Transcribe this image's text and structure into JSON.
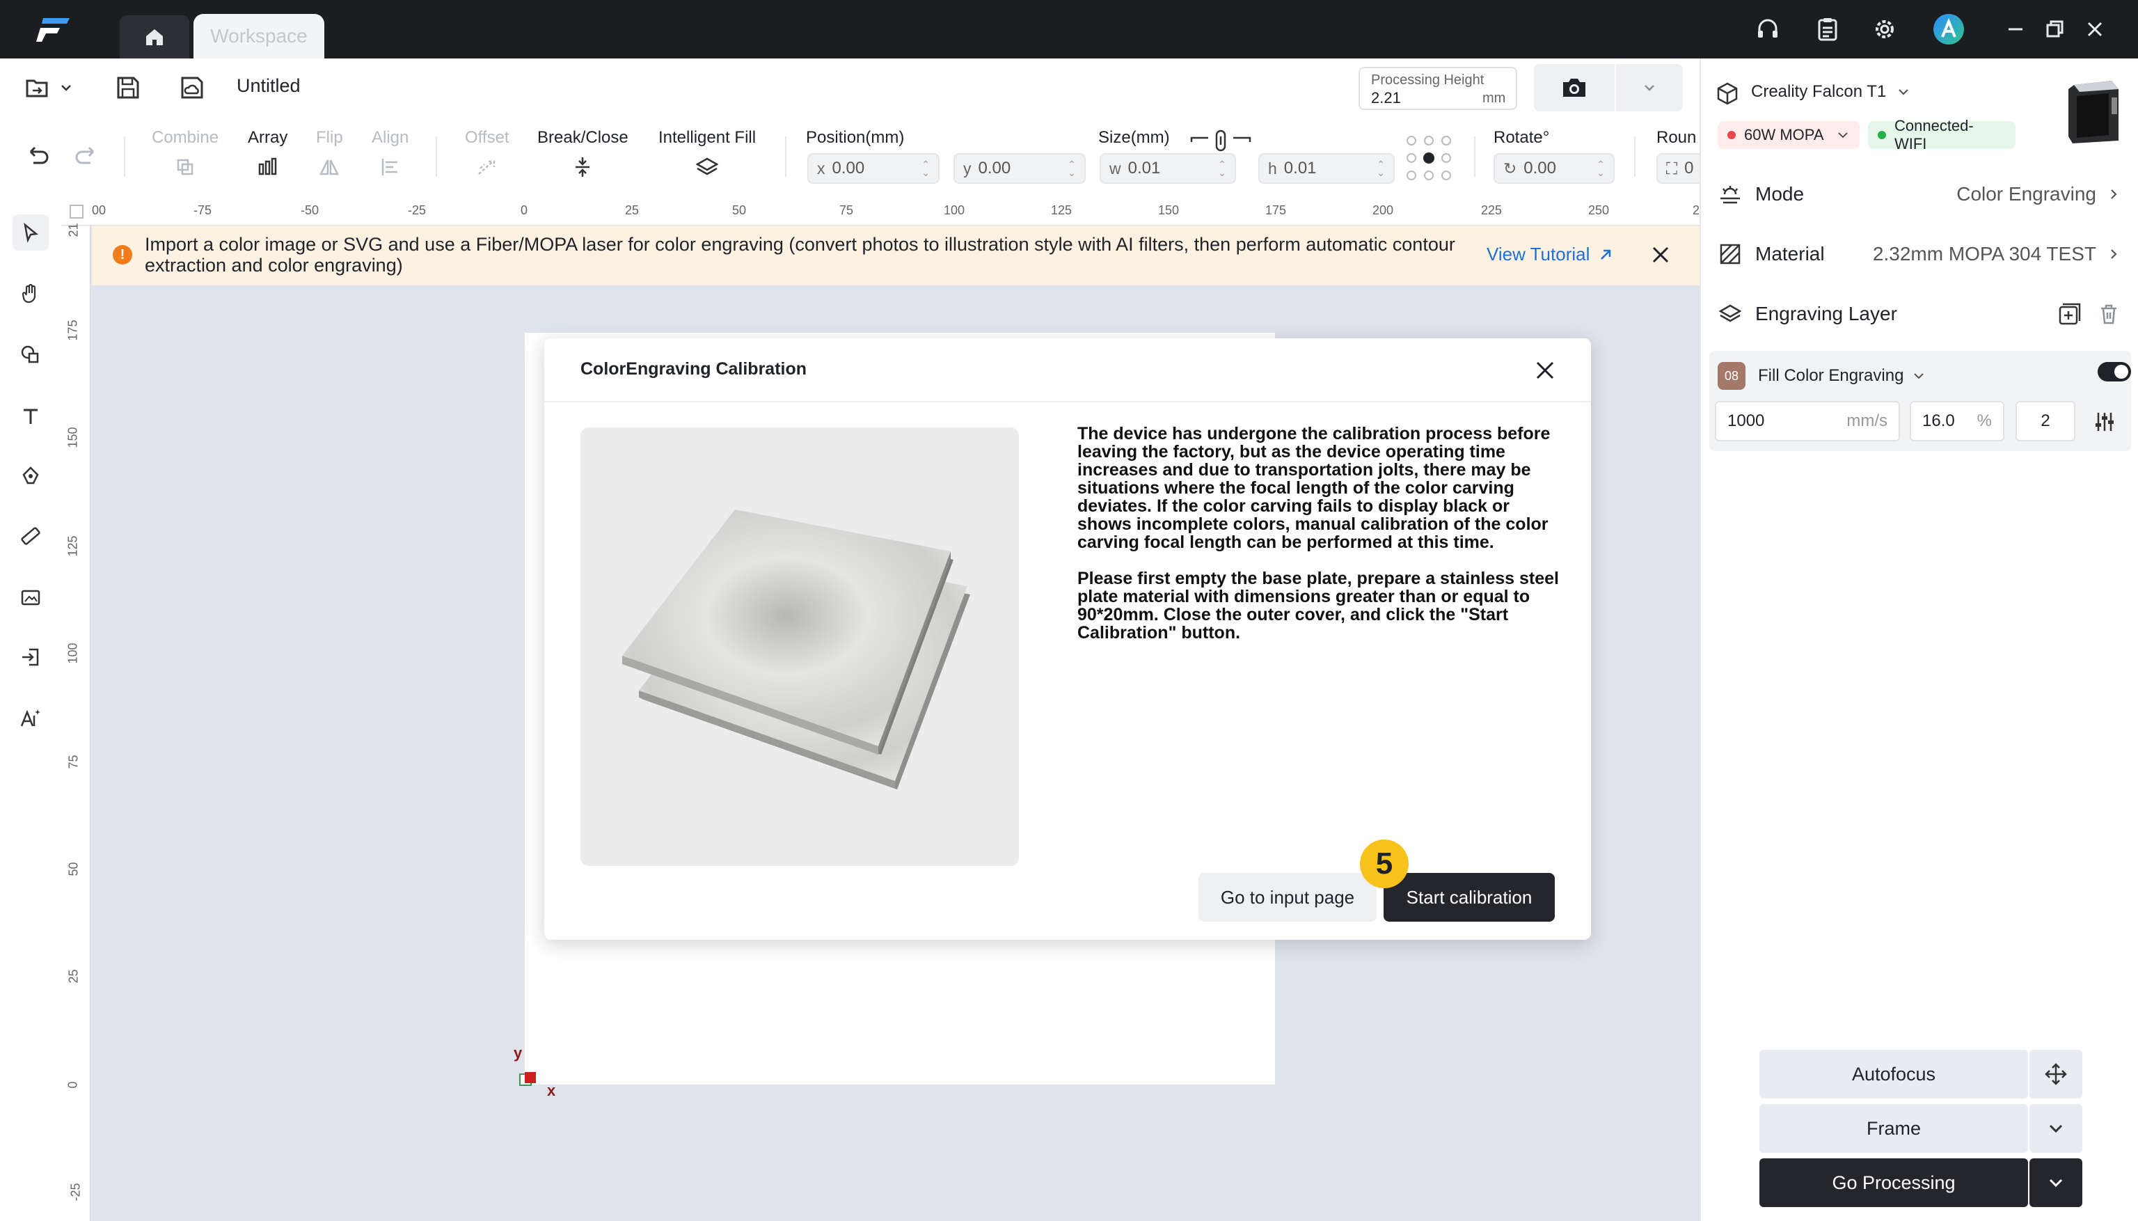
{
  "titlebar": {
    "workspace_tab": "Workspace",
    "icons": [
      "app-logo",
      "home-icon",
      "headset-icon",
      "clipboard-icon",
      "gear-icon",
      "avatar",
      "minimize-icon",
      "restore-icon",
      "close-icon"
    ]
  },
  "toolbar": {
    "document_title": "Untitled",
    "processing_height_label": "Processing Height",
    "processing_height_value": "2.21",
    "processing_height_unit": "mm"
  },
  "tools": {
    "combine": "Combine",
    "array": "Array",
    "flip": "Flip",
    "align": "Align",
    "offset": "Offset",
    "break_close": "Break/Close",
    "intelligent_fill": "Intelligent Fill",
    "position_label": "Position(mm)",
    "x_prefix": "x",
    "x_value": "0.00",
    "y_prefix": "y",
    "y_value": "0.00",
    "size_label": "Size(mm)",
    "w_prefix": "w",
    "w_value": "0.01",
    "h_prefix": "h",
    "h_value": "0.01",
    "rotate_label": "Rotate°",
    "rotate_value": "0.00",
    "round_label": "Roun",
    "round_value": "0"
  },
  "ruler": {
    "h_ticks": [
      "00",
      "-75",
      "-50",
      "-25",
      "0",
      "25",
      "50",
      "75",
      "100",
      "125",
      "150",
      "175",
      "200",
      "225",
      "250",
      "2"
    ],
    "v_ticks": [
      "21",
      "175",
      "150",
      "125",
      "100",
      "75",
      "50",
      "25",
      "0",
      "-25"
    ]
  },
  "banner": {
    "text": "Import a color image or SVG and use a Fiber/MOPA laser for color engraving (convert photos to illustration style with AI filters, then perform automatic contour extraction and color engraving)",
    "link": "View Tutorial"
  },
  "canvas": {
    "axis_x": "x",
    "axis_y": "y"
  },
  "dialog": {
    "title": "ColorEngraving Calibration",
    "paragraph1": "The device has undergone the calibration process before leaving the factory, but as the device operating time increases and due to transportation jolts, there may be situations where the focal length of the color carving deviates. If the color carving fails to display black or shows incomplete colors, manual calibration of the color carving focal length can be performed at this time.",
    "paragraph2": "Please first empty the base plate, prepare a stainless steel plate material with dimensions greater than or equal to 90*20mm. Close the outer cover, and click the \"Start Calibration\" button.",
    "secondary_button": "Go to input page",
    "primary_button": "Start calibration",
    "step_badge": "5"
  },
  "right_panel": {
    "device_name": "Creality Falcon T1",
    "laser_module": "60W MOPA",
    "connection": "Connected-WIFI",
    "mode_label": "Mode",
    "mode_value": "Color Engraving",
    "material_label": "Material",
    "material_value": "2.32mm MOPA 304 TEST",
    "layer_section": "Engraving Layer",
    "layer_number": "08",
    "layer_name": "Fill Color Engraving",
    "speed_value": "1000",
    "speed_unit": "mm/s",
    "power_value": "16.0",
    "power_unit": "%",
    "passes_value": "2",
    "autofocus": "Autofocus",
    "frame": "Frame",
    "go_processing": "Go Processing"
  },
  "colors": {
    "accent_blue": "#1f6fd6",
    "banner_bg": "#fdf2e2",
    "badge_yellow": "#f7c21a",
    "dark_button": "#24262b",
    "connected_green": "#25b04a",
    "module_red": "#e5484d"
  }
}
